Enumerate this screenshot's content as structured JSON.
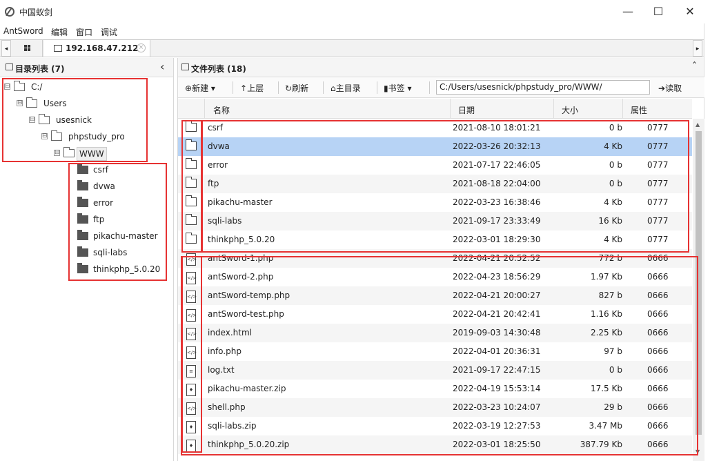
{
  "window": {
    "title": "中国蚁剑",
    "minimize": "—",
    "maximize": "☐",
    "close": "✕"
  },
  "menu": [
    "AntSword",
    "编辑",
    "窗口",
    "调试"
  ],
  "tabs": {
    "left_arrow": "◂",
    "right_arrow": "▸",
    "active_tab": "192.168.47.212",
    "close": "×"
  },
  "dir_panel": {
    "title": "目录列表 (7)",
    "collapse": "‹",
    "tree": [
      {
        "label": "C:/",
        "expander": "⊟"
      },
      {
        "label": "Users",
        "expander": "⊟"
      },
      {
        "label": "usesnick",
        "expander": "⊟"
      },
      {
        "label": "phpstudy_pro",
        "expander": "⊟"
      },
      {
        "label": "WWW",
        "expander": "⊟"
      }
    ],
    "children": [
      "csrf",
      "dvwa",
      "error",
      "ftp",
      "pikachu-master",
      "sqli-labs",
      "thinkphp_5.0.20"
    ]
  },
  "file_panel": {
    "title": "文件列表 (18)",
    "collapse": "ˆ",
    "toolbar": {
      "new": "新建",
      "up": "上层",
      "refresh": "刷新",
      "home": "主目录",
      "bookmark": "书签",
      "path": "C:/Users/usesnick/phpstudy_pro/WWW/",
      "read": "读取"
    },
    "columns": [
      "名称",
      "日期",
      "大小",
      "属性"
    ],
    "files": [
      {
        "name": "csrf",
        "date": "2021-08-10 18:01:21",
        "size": "0 b",
        "mode": "0777",
        "type": "folder"
      },
      {
        "name": "dvwa",
        "date": "2022-03-26 20:32:13",
        "size": "4 Kb",
        "mode": "0777",
        "type": "folder"
      },
      {
        "name": "error",
        "date": "2021-07-17 22:46:05",
        "size": "0 b",
        "mode": "0777",
        "type": "folder"
      },
      {
        "name": "ftp",
        "date": "2021-08-18 22:04:00",
        "size": "0 b",
        "mode": "0777",
        "type": "folder"
      },
      {
        "name": "pikachu-master",
        "date": "2022-03-23 16:38:46",
        "size": "4 Kb",
        "mode": "0777",
        "type": "folder"
      },
      {
        "name": "sqli-labs",
        "date": "2021-09-17 23:33:49",
        "size": "16 Kb",
        "mode": "0777",
        "type": "folder"
      },
      {
        "name": "thinkphp_5.0.20",
        "date": "2022-03-01 18:29:30",
        "size": "4 Kb",
        "mode": "0777",
        "type": "folder"
      },
      {
        "name": "antSword-1.php",
        "date": "2022-04-21 20:52:52",
        "size": "772 b",
        "mode": "0666",
        "type": "code"
      },
      {
        "name": "antSword-2.php",
        "date": "2022-04-23 18:56:29",
        "size": "1.97 Kb",
        "mode": "0666",
        "type": "code"
      },
      {
        "name": "antSword-temp.php",
        "date": "2022-04-21 20:00:27",
        "size": "827 b",
        "mode": "0666",
        "type": "code"
      },
      {
        "name": "antSword-test.php",
        "date": "2022-04-21 20:42:41",
        "size": "1.16 Kb",
        "mode": "0666",
        "type": "code"
      },
      {
        "name": "index.html",
        "date": "2019-09-03 14:30:48",
        "size": "2.25 Kb",
        "mode": "0666",
        "type": "code"
      },
      {
        "name": "info.php",
        "date": "2022-04-01 20:36:31",
        "size": "97 b",
        "mode": "0666",
        "type": "code"
      },
      {
        "name": "log.txt",
        "date": "2021-09-17 22:47:15",
        "size": "0 b",
        "mode": "0666",
        "type": "text"
      },
      {
        "name": "pikachu-master.zip",
        "date": "2022-04-19 15:53:14",
        "size": "17.5 Kb",
        "mode": "0666",
        "type": "zip"
      },
      {
        "name": "shell.php",
        "date": "2022-03-23 10:24:07",
        "size": "29 b",
        "mode": "0666",
        "type": "code"
      },
      {
        "name": "sqli-labs.zip",
        "date": "2022-03-19 12:27:53",
        "size": "3.47 Mb",
        "mode": "0666",
        "type": "zip"
      },
      {
        "name": "thinkphp_5.0.20.zip",
        "date": "2022-03-01 18:25:50",
        "size": "387.79 Kb",
        "mode": "0666",
        "type": "zip"
      }
    ],
    "selected_row": "dvwa"
  },
  "icons": {
    "file_code": "</>",
    "file_text": "≡",
    "file_zip": "♦",
    "new": "⊕",
    "up": "↑",
    "refresh": "↻",
    "home": "⌂",
    "bookmark": "▮",
    "read": "➔",
    "dropdown": "▾"
  },
  "colors": {
    "selected_row": "#b7d3f5",
    "annotation_box": "#e63232",
    "row_alt": "#f5f5f5"
  }
}
